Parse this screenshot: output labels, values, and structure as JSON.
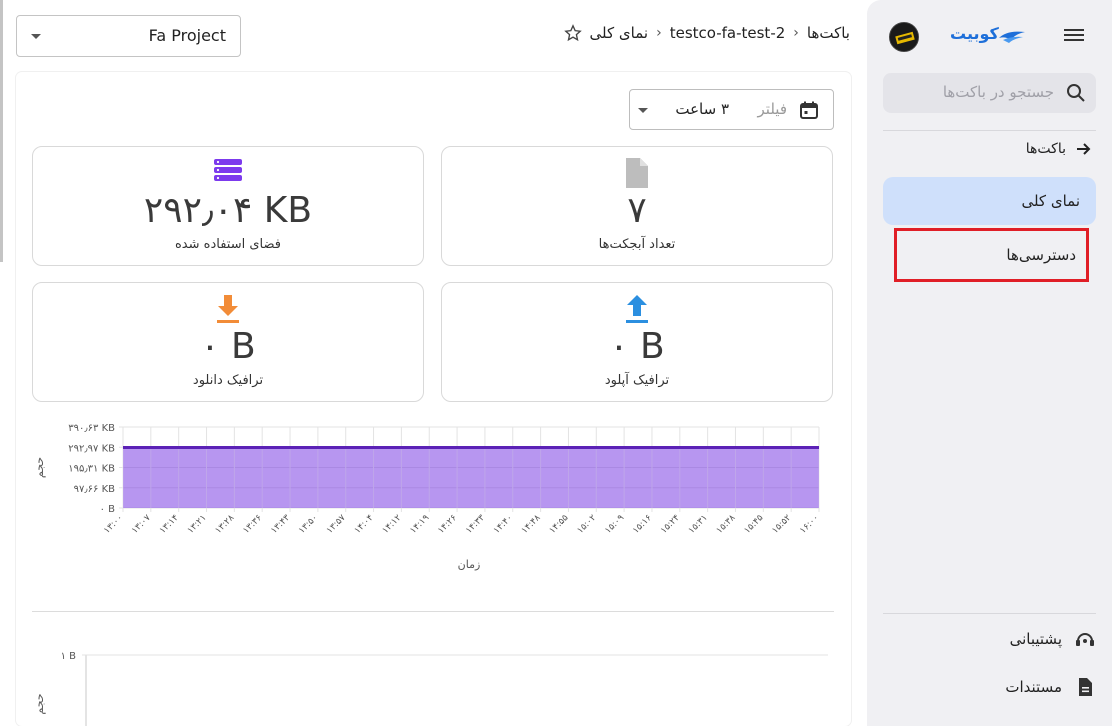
{
  "sidebar": {
    "brand": "کوبیت",
    "search_placeholder": "جستجو در باکت‌ها",
    "back_label": "باکت‌ها",
    "items": [
      {
        "label": "نمای کلی",
        "active": true
      },
      {
        "label": "دسترسی‌ها",
        "highlighted": true
      }
    ],
    "footer": [
      {
        "label": "پشتیبانی",
        "icon": "support-icon"
      },
      {
        "label": "مستندات",
        "icon": "document-icon"
      }
    ]
  },
  "topbar": {
    "project": "Fa Project",
    "breadcrumb": [
      "باکت‌ها",
      "testco-fa-test-2",
      "نمای کلی"
    ]
  },
  "filter": {
    "label": "فیلتر",
    "value": "۳ ساعت"
  },
  "stats": [
    {
      "value": "۲۹۲٫۰۴ KB",
      "label": "فضای استفاده شده",
      "icon": "database-icon",
      "color": "#7c3aed"
    },
    {
      "value": "۷",
      "label": "تعداد آبجکت‌ها",
      "icon": "file-icon",
      "color": "#bdbdbd"
    },
    {
      "value": "۰ B",
      "label": "ترافیک دانلود",
      "icon": "download-icon",
      "color": "#f28c38"
    },
    {
      "value": "۰ B",
      "label": "ترافیک آپلود",
      "icon": "upload-icon",
      "color": "#2b8fe0"
    }
  ],
  "chart_data": [
    {
      "type": "area",
      "ylabel": "حجم",
      "xlabel": "زمان",
      "yticks": [
        "۰ B",
        "۹۷٫۶۶ KB",
        "۱۹۵٫۳۱ KB",
        "۲۹۲٫۹۷ KB",
        "۳۹۰٫۶۳ KB"
      ],
      "ylim": [
        0,
        390.63
      ],
      "x": [
        "۱۳:۰۰",
        "۱۳:۰۷",
        "۱۳:۱۴",
        "۱۳:۲۱",
        "۱۳:۲۸",
        "۱۳:۳۶",
        "۱۳:۴۳",
        "۱۳:۵۰",
        "۱۳:۵۷",
        "۱۴:۰۴",
        "۱۴:۱۲",
        "۱۴:۱۹",
        "۱۴:۲۶",
        "۱۴:۳۳",
        "۱۴:۴۰",
        "۱۴:۴۸",
        "۱۴:۵۵",
        "۱۵:۰۲",
        "۱۵:۰۹",
        "۱۵:۱۶",
        "۱۵:۲۴",
        "۱۵:۳۱",
        "۱۵:۳۸",
        "۱۵:۴۵",
        "۱۵:۵۲",
        "۱۶:۰۰"
      ],
      "series": [
        {
          "values": [
            292.04,
            292.04,
            292.04,
            292.04,
            292.04,
            292.04,
            292.04,
            292.04,
            292.04,
            292.04,
            292.04,
            292.04,
            292.04,
            292.04,
            292.04,
            292.04,
            292.04,
            292.04,
            292.04,
            292.04,
            292.04,
            292.04,
            292.04,
            292.04,
            292.04,
            292.04
          ],
          "color": "#7b3fe4"
        }
      ],
      "grid": true
    },
    {
      "type": "line",
      "ylabel": "حجم",
      "yticks": [
        "۱ B"
      ],
      "ylim": [
        0,
        1
      ],
      "grid": true
    }
  ]
}
